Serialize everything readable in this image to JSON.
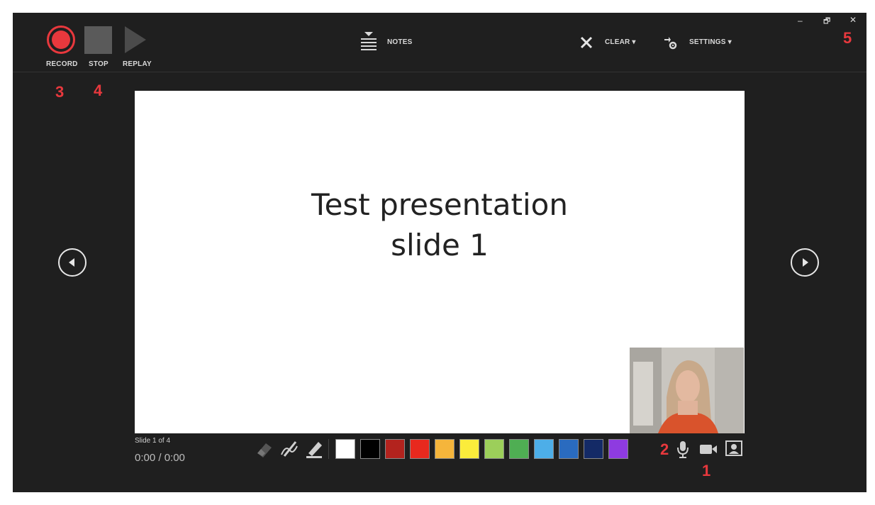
{
  "toolbar": {
    "record_label": "RECORD",
    "stop_label": "STOP",
    "replay_label": "REPLAY",
    "notes_label": "NOTES",
    "clear_label": "CLEAR ▾",
    "settings_label": "SETTINGS ▾"
  },
  "annotations": {
    "camera": "1",
    "microphone": "2",
    "record": "3",
    "stop": "4",
    "close": "5"
  },
  "slide": {
    "title": "Test presentation\nslide 1",
    "counter": "Slide 1 of 4",
    "time": "0:00 / 0:00"
  },
  "window_controls": {
    "minimize": "–",
    "restore": "🗗",
    "close": "✕"
  },
  "icons": [
    "record-icon",
    "stop-icon",
    "replay-icon",
    "notes-icon",
    "clear-icon",
    "settings-icon",
    "previous-slide-icon",
    "next-slide-icon",
    "eraser-icon",
    "pen-icon",
    "highlighter-icon",
    "microphone-icon",
    "camera-icon",
    "camera-preview-icon"
  ],
  "colors": {
    "background": "#1f1f1f",
    "record": "#e8383d",
    "annotation": "#e8383d",
    "swatches": [
      "#ffffff",
      "#000000",
      "#b3231e",
      "#e8291e",
      "#f5b53b",
      "#fbec3b",
      "#9ccf5a",
      "#4fae53",
      "#4daee8",
      "#2a6bbf",
      "#142a66",
      "#8e3be0"
    ]
  }
}
